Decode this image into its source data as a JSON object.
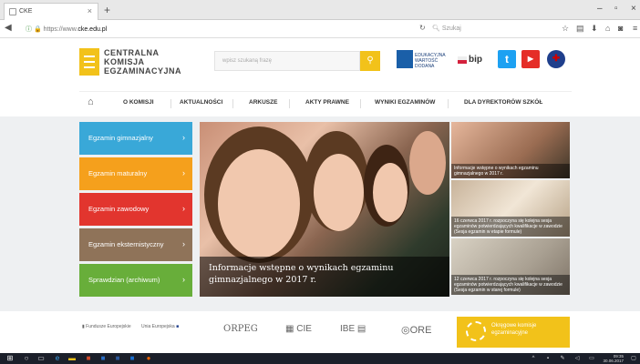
{
  "browser": {
    "tab_title": "CKE",
    "tab_close": "×",
    "new_tab": "+",
    "url_prefix": "https://www.",
    "url_domain": "cke.edu.pl",
    "search_placeholder": "Szukaj",
    "win_min": "–",
    "win_max": "▫",
    "win_close": "×"
  },
  "site": {
    "logo_line1": "CENTRALNA",
    "logo_line2": "KOMISJA",
    "logo_line3": "EGZAMINACYJNA",
    "search_placeholder": "wpisz szukaną frazę",
    "partner_line1": "EDUKACYJNA",
    "partner_line2": "WARTOŚĆ",
    "partner_line3": "DODANA",
    "bip": "bip"
  },
  "menu": [
    {
      "label": "O KOMISJI"
    },
    {
      "label": "AKTUALNOŚCI"
    },
    {
      "label": "ARKUSZE"
    },
    {
      "label": "AKTY PRAWNE"
    },
    {
      "label": "WYNIKI EGZAMINÓW"
    },
    {
      "label": "DLA DYREKTORÓW SZKÓŁ"
    }
  ],
  "exam_buttons": [
    {
      "label": "Egzamin gimnazjalny",
      "color": "#39a8d8"
    },
    {
      "label": "Egzamin maturalny",
      "color": "#f5a01c"
    },
    {
      "label": "Egzamin zawodowy",
      "color": "#e2352e"
    },
    {
      "label": "Egzamin eksternistyczny",
      "color": "#8f7359"
    },
    {
      "label": "Sprawdzian (archiwum)",
      "color": "#68ae3a"
    }
  ],
  "banner": {
    "caption_line1": "Informacje wstępne o wynikach egzaminu",
    "caption_line2": "gimnazjalnego w 2017 r."
  },
  "news": [
    {
      "text": "Informacje wstępne o wynikach egzaminu gimnazjalnego w 2017 r."
    },
    {
      "text": "16 czerwca 2017 r. rozpoczyna się kolejna sesja egzaminów potwierdzających kwalifikacje w zawodzie (Sesja egzamin w etapie formule)"
    },
    {
      "text": "12 czerwca 2017 r. rozpoczyna się kolejna sesja egzaminów potwierdzających kwalifikacje w zawodzie (Sesja egzamin w starej formule)"
    }
  ],
  "footer": {
    "fundusze": "Fundusze Europejskie",
    "ue": "Unia Europejska",
    "orpeg": "ORPEG",
    "cie": "CIE",
    "ibe": "IBE",
    "ore": "ORE",
    "okegz_line1": "Okręgowe komisje",
    "okegz_line2": "egzaminacyjne"
  },
  "taskbar": {
    "time": "09:35",
    "date": "30.06.2017"
  }
}
